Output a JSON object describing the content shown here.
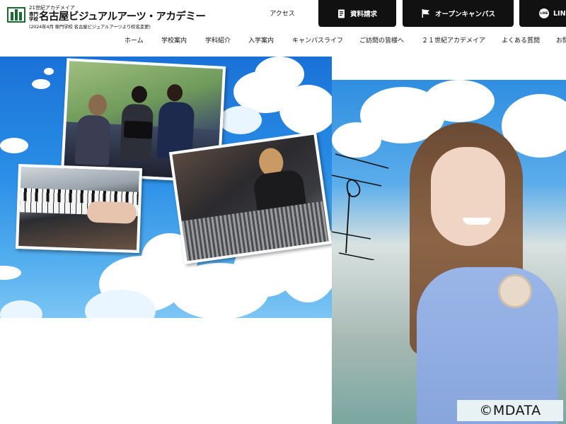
{
  "logo": {
    "tagline": "21世紀アカデメイア",
    "prefix": "専門\n学校",
    "name": "名古屋ビジュアルアーツ・アカデミー",
    "note": "(2024年4月 専門学校 名古屋ビジュアルアーツより校名変更)"
  },
  "header": {
    "access_label": "アクセス",
    "cta": {
      "request_label": "資料請求",
      "open_campus_label": "オープンキャンパス",
      "line_label": "LIN",
      "line_badge": "LINE"
    }
  },
  "nav": [
    "ホーム",
    "学校案内",
    "学科紹介",
    "入学案内",
    "キャンパスライフ",
    "ご訪問の皆様へ",
    "２１世紀アカデメイア",
    "よくある質問",
    "お問"
  ],
  "hero": {
    "sky_color": "#2a8ee6",
    "photos": [
      "video-shoot-photo",
      "piano-photo",
      "studio-mixing-photo"
    ]
  },
  "watermark": "©MDATA"
}
